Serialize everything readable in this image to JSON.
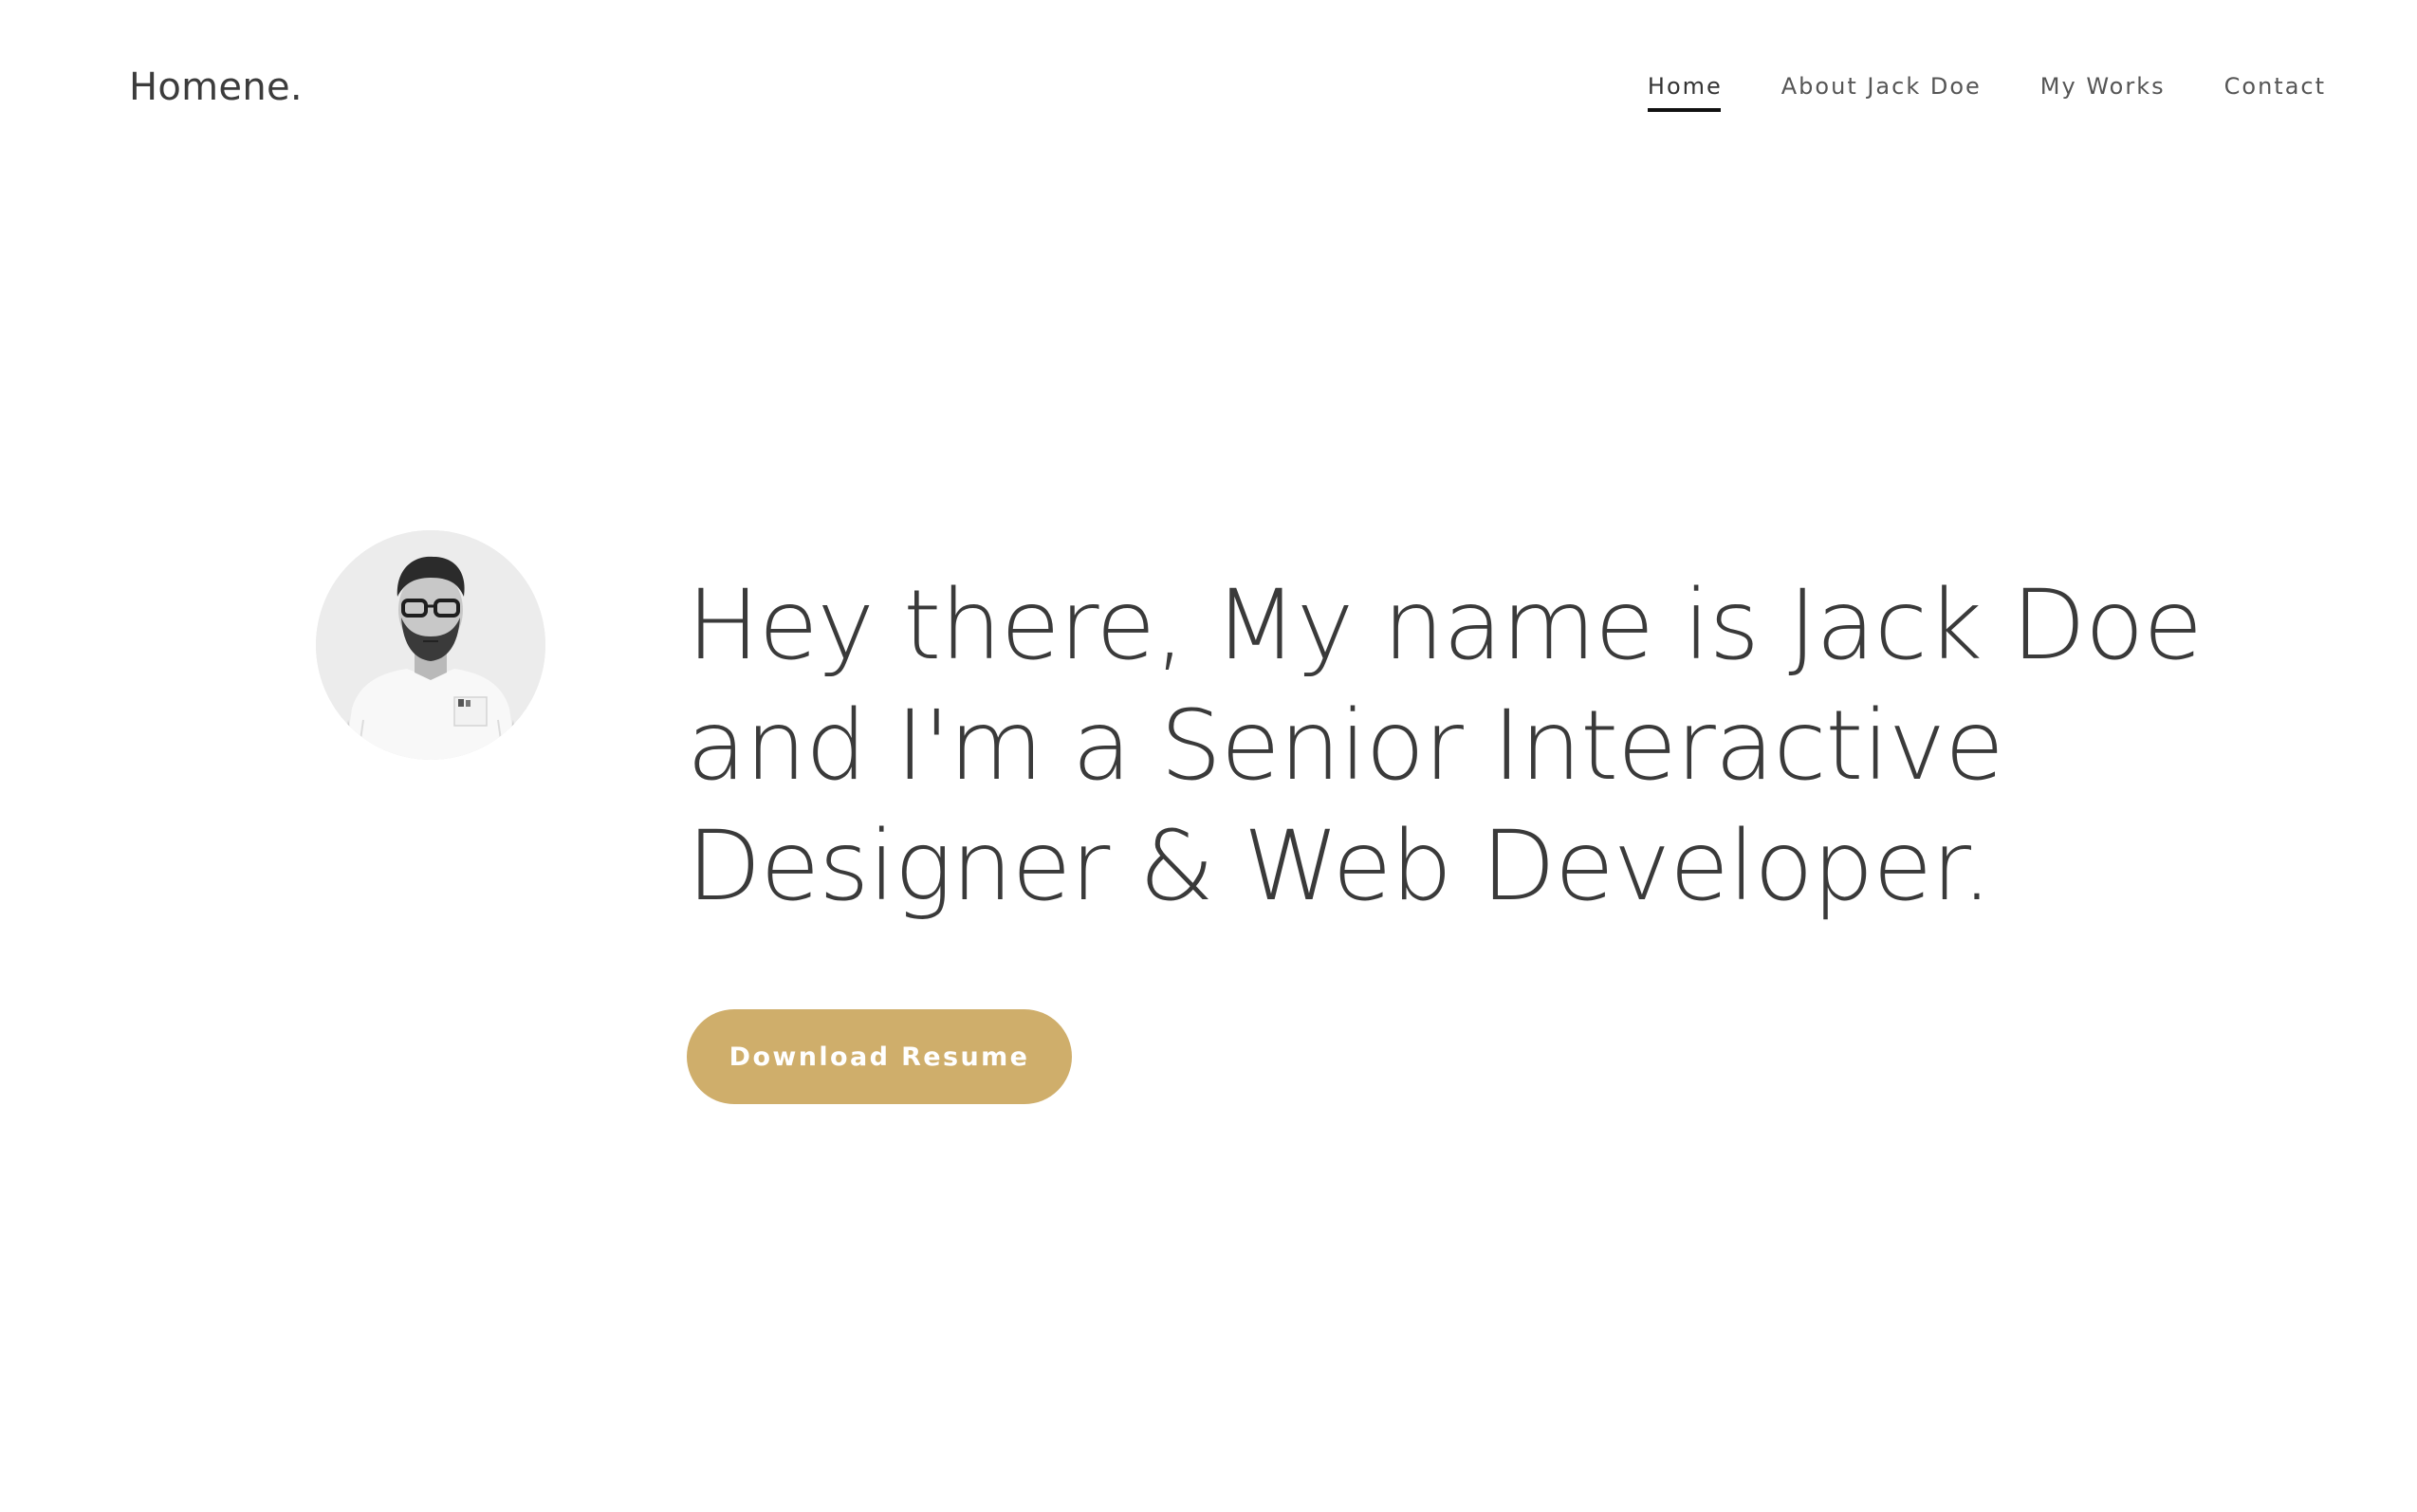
{
  "header": {
    "logo": "Homene.",
    "nav": [
      {
        "label": "Home",
        "active": true
      },
      {
        "label": "About Jack Doe",
        "active": false
      },
      {
        "label": "My Works",
        "active": false
      },
      {
        "label": "Contact",
        "active": false
      }
    ]
  },
  "hero": {
    "avatar_icon": "profile-photo",
    "headline_lines": [
      "Hey there, My name is Jack Doe",
      "and I'm a Senior Interactive",
      "Designer & Web Developer."
    ],
    "button_label": "Download Resume"
  },
  "colors": {
    "accent": "#cfae6b",
    "text": "#3a3a3a",
    "nav_text": "#555555",
    "background": "#ffffff"
  }
}
